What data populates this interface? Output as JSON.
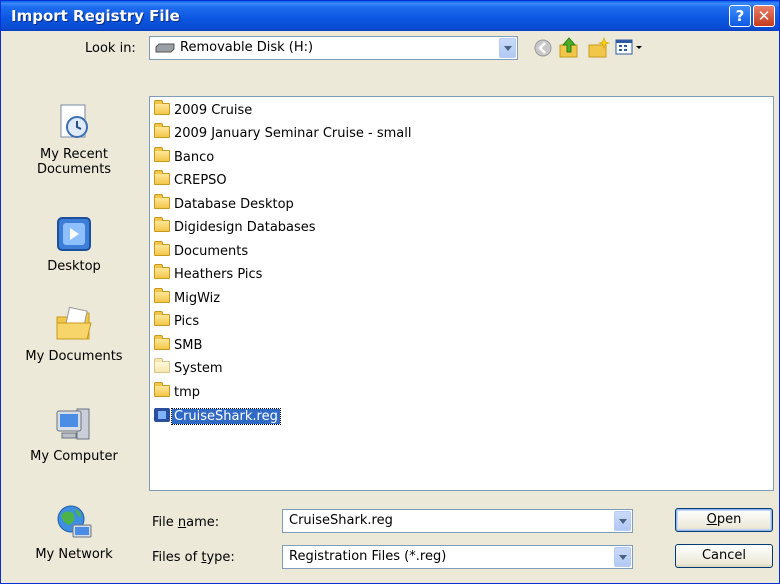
{
  "window": {
    "title": "Import Registry File"
  },
  "lookin": {
    "label": "Look in:",
    "value": "Removable Disk (H:)"
  },
  "toolbar": {
    "icons": [
      "back-icon",
      "up-folder-icon",
      "new-folder-icon",
      "views-menu-icon"
    ]
  },
  "places": [
    {
      "label_line1": "My Recent",
      "label_line2": "Documents",
      "icon": "recent-documents-icon"
    },
    {
      "label_line1": "Desktop",
      "label_line2": "",
      "icon": "desktop-icon"
    },
    {
      "label_line1": "My Documents",
      "label_line2": "",
      "icon": "my-documents-icon"
    },
    {
      "label_line1": "My Computer",
      "label_line2": "",
      "icon": "my-computer-icon"
    },
    {
      "label_line1": "My Network",
      "label_line2": "",
      "icon": "my-network-icon"
    }
  ],
  "files": [
    {
      "name": "2009 Cruise",
      "type": "folder"
    },
    {
      "name": "2009 January Seminar Cruise - small",
      "type": "folder"
    },
    {
      "name": "Banco",
      "type": "folder"
    },
    {
      "name": "CREPSO",
      "type": "folder"
    },
    {
      "name": "Database Desktop",
      "type": "folder"
    },
    {
      "name": "Digidesign Databases",
      "type": "folder"
    },
    {
      "name": "Documents",
      "type": "folder"
    },
    {
      "name": "Heathers Pics",
      "type": "folder"
    },
    {
      "name": "MigWiz",
      "type": "folder"
    },
    {
      "name": "Pics",
      "type": "folder"
    },
    {
      "name": "SMB",
      "type": "folder"
    },
    {
      "name": "System",
      "type": "hidden-folder"
    },
    {
      "name": "tmp",
      "type": "folder"
    },
    {
      "name": "CruiseShark.reg",
      "type": "reg",
      "selected": true
    }
  ],
  "filename": {
    "label_pre": "File ",
    "label_u": "n",
    "label_post": "ame:",
    "value": "CruiseShark.reg"
  },
  "filetype": {
    "label_pre": "Files of ",
    "label_u": "t",
    "label_post": "ype:",
    "value": "Registration Files (*.reg)"
  },
  "buttons": {
    "open_u": "O",
    "open_rest": "pen",
    "cancel": "Cancel"
  },
  "colors": {
    "titlebar": "#0a5fe8",
    "selection": "#316ac5",
    "dialog_bg": "#ece9d8"
  }
}
